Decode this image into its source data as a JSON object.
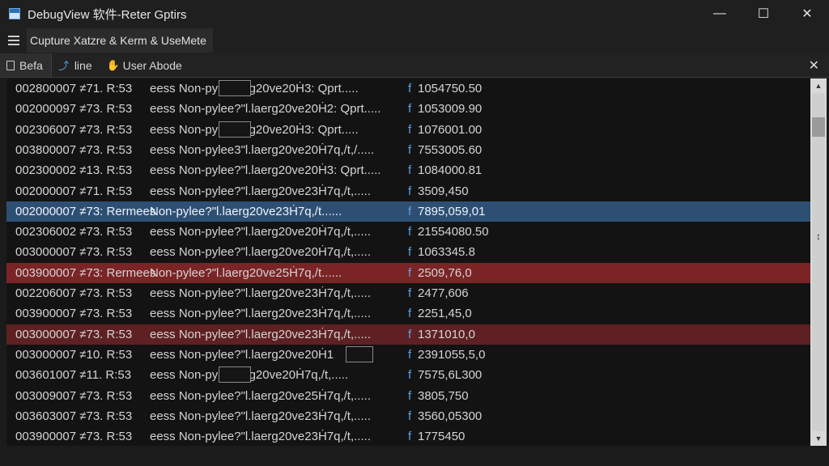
{
  "window": {
    "title": "DebugView 软件-Reter Gptirs",
    "minimize_glyph": "—",
    "maximize_glyph": "☐",
    "close_glyph": "✕"
  },
  "menu": {
    "label": "Cupture Xatzre & Kerm & UseMete"
  },
  "tabs": [
    {
      "label": "Befa",
      "icon": "document-icon"
    },
    {
      "label": "line",
      "icon": "line-chart-icon"
    },
    {
      "label": "User Abode",
      "icon": "user-mode-icon"
    }
  ],
  "tab_close_glyph": "✕",
  "rows": [
    {
      "proc": "002800007 ≠71. R:53",
      "msg": "eess Non-py       }.laerg20ve20Ḣ3: Qprt.....",
      "flag": "f",
      "value": "1054750.50",
      "style": "normal",
      "box": true
    },
    {
      "proc": "002000097 ≠73. R:53",
      "msg": "eess Non-pylee?\"l.laerg20ve20Ḣ2: Qprt.....",
      "flag": "f",
      "value": "1053009.90",
      "style": "normal",
      "box": false
    },
    {
      "proc": "002306007 ≠73. R:53",
      "msg": "eess Non-py       }.laerg20ve20Ḣ3: Qprt.....",
      "flag": "f",
      "value": "1076001.00",
      "style": "normal",
      "box": true
    },
    {
      "proc": "003800007 ≠73. R:53",
      "msg": "eess Non-pylee3\"l.laerg20ve20Ḣ7q,/t,/.....",
      "flag": "f",
      "value": "7553005.60",
      "style": "normal",
      "box": false
    },
    {
      "proc": "002300002 ≠13. R:53",
      "msg": "eess Non-pylee?\"l.laerg20ve20Ḣ3: Qprt.....",
      "flag": "f",
      "value": "1084000.81",
      "style": "normal",
      "box": false
    },
    {
      "proc": "002000007 ≠71. R:53",
      "msg": "eess Non-pylee?\"l.laerg20ve23Ḣ7q,/t,.....",
      "flag": "f",
      "value": "3509,450",
      "style": "normal",
      "box": false
    },
    {
      "proc": "002000007 ≠73: Rermees",
      "msg": "Non-pylee?\"l.laerg20ve23Ḣ7q,/t......",
      "flag": "f",
      "value": "7895,059,01",
      "style": "sel",
      "box": false
    },
    {
      "proc": "002306002 ≠73. R:53",
      "msg": "eess Non-pylee?\"l.laerg20ve20Ḣ7q,/t,.....",
      "flag": "f",
      "value": "21554080.50",
      "style": "normal",
      "box": false
    },
    {
      "proc": "003000007 ≠73. R:53",
      "msg": "eess Non-pylee?\"l.laerg20ve20Ḣ7q,/t,.....",
      "flag": "f",
      "value": "1063345.8",
      "style": "normal",
      "box": false
    },
    {
      "proc": "003900007 ≠73: Rermees",
      "msg": "Non-pylee?\"l.laerg20ve25Ḣ7q,/t......",
      "flag": "f",
      "value": "2509,76,0",
      "style": "red",
      "box": false
    },
    {
      "proc": "002206007 ≠73. R:53",
      "msg": "eess Non-pylee?\"l.laerg20ve23Ḣ7q,/t,.....",
      "flag": "f",
      "value": "2477,606",
      "style": "normal",
      "box": false
    },
    {
      "proc": "003900007 ≠73. R:53",
      "msg": "eess Non-pylee?\"l.laerg20ve23Ḣ7q,/t,.....",
      "flag": "f",
      "value": "2251,45,0",
      "style": "normal",
      "box": false
    },
    {
      "proc": "003000007 ≠73. R:53",
      "msg": "eess Non-pylee?\"l.laerg20ve23Ḣ7q,/t,.....",
      "flag": "f",
      "value": "1371010,0",
      "style": "darkred",
      "box": false
    },
    {
      "proc": "003000007 ≠10. R:53",
      "msg": "eess Non-pylee?\"l.laerg20ve20Ḣ1       ",
      "flag": "f",
      "value": "2391055,5,0",
      "style": "normal",
      "box": true
    },
    {
      "proc": "003601007 ≠11. R:53",
      "msg": "eess Non-py       }.laerg20ve20Ḣ7q,/t,.....",
      "flag": "f",
      "value": "7575,6L300",
      "style": "normal",
      "box": true
    },
    {
      "proc": "003009007 ≠73. R:53",
      "msg": "eess Non-pylee?\"l.laerg20ve25Ḣ7q,/t,.....",
      "flag": "f",
      "value": "3805,750",
      "style": "normal",
      "box": false
    },
    {
      "proc": "003603007 ≠73. R:53",
      "msg": "eess Non-pylee?\"l.laerg20ve23Ḣ7q,/t,.....",
      "flag": "f",
      "value": "3560,05300",
      "style": "normal",
      "box": false
    },
    {
      "proc": "003900007 ≠73. R:53",
      "msg": "eess Non-pylee?\"l.laerg20ve23Ḣ7q,/t,.....",
      "flag": "f",
      "value": "1775450",
      "style": "normal",
      "box": false
    }
  ],
  "scrollbar": {
    "up_glyph": "▲",
    "down_glyph": "▼",
    "grip_glyph": "↕"
  },
  "colors": {
    "selected_row": "#2e4f74",
    "error_row": "#7a2426",
    "warning_row": "#5e2022",
    "accent": "#5aa0e6"
  }
}
